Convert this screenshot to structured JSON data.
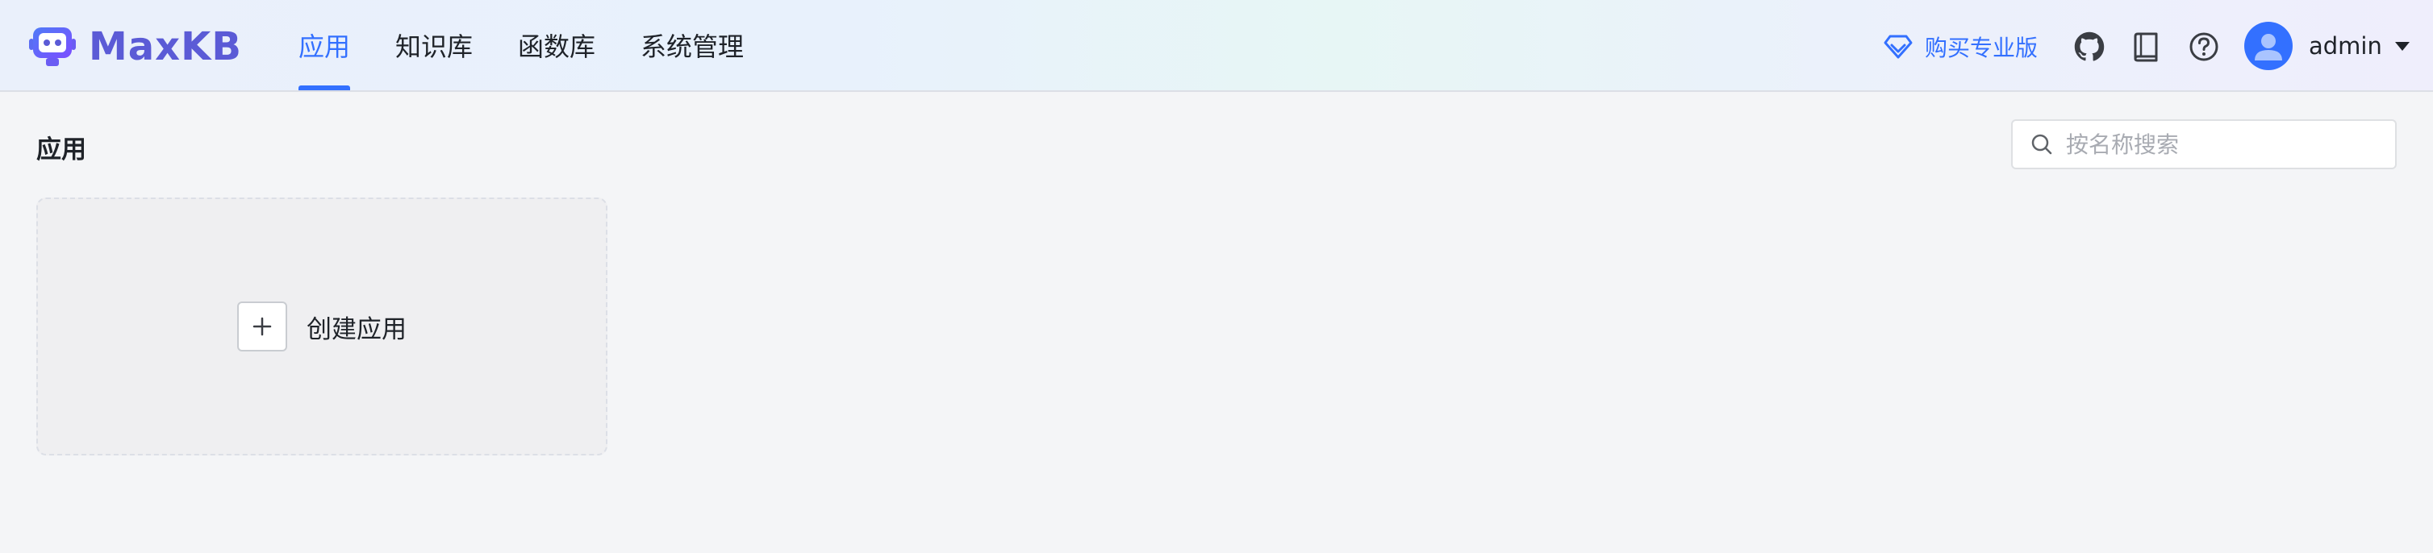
{
  "app": {
    "name": "MaxKB"
  },
  "nav": {
    "items": [
      {
        "label": "应用",
        "active": true
      },
      {
        "label": "知识库",
        "active": false
      },
      {
        "label": "函数库",
        "active": false
      },
      {
        "label": "系统管理",
        "active": false
      }
    ]
  },
  "header": {
    "buy_label": "购买专业版",
    "icons": [
      "github-icon",
      "docs-book-icon",
      "help-icon"
    ],
    "user": {
      "name": "admin"
    }
  },
  "main": {
    "title": "应用",
    "search": {
      "placeholder": "按名称搜索",
      "value": ""
    },
    "create_card": {
      "label": "创建应用"
    }
  },
  "colors": {
    "accent": "#3370ff",
    "brand": "#5b5bd6",
    "background": "#f4f5f7"
  }
}
